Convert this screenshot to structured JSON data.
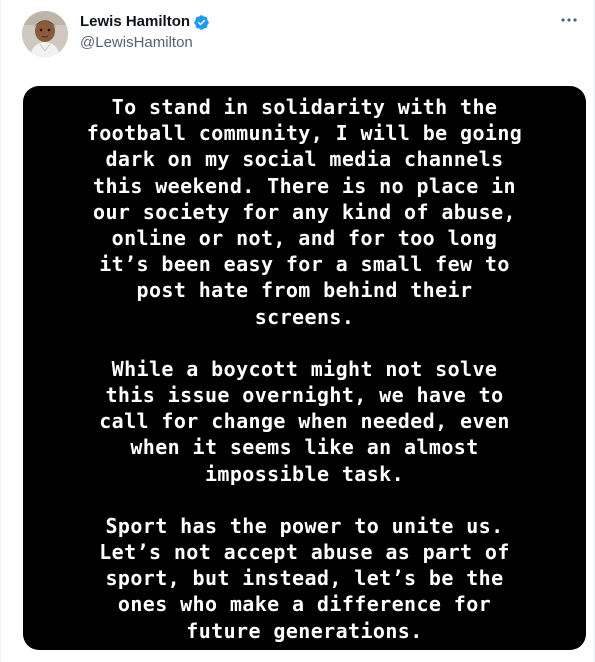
{
  "author": {
    "display_name": "Lewis Hamilton",
    "handle": "@LewisHamilton",
    "verified": true,
    "verified_color": "#1d9bf0",
    "avatar_icon": "avatar-photo"
  },
  "actions": {
    "more_icon": "more-horizontal-icon"
  },
  "media": {
    "background_color": "#000000",
    "text_color": "#ffffff",
    "paragraphs": [
      {
        "lines": [
          "To stand in solidarity with the",
          "football community, I will be going",
          "dark on my social media channels",
          "this weekend. There is no place in",
          "our society for any kind of abuse,",
          "online or not, and for too long",
          "it’s been easy for a small few to",
          "post hate from behind their",
          "screens."
        ]
      },
      {
        "lines": [
          "While a boycott might not solve",
          "this issue overnight, we have to",
          "call for change when needed, even",
          "when it seems like an almost",
          "impossible task."
        ]
      },
      {
        "lines": [
          "Sport has the power to unite us.",
          "Let’s not accept abuse as part of",
          "sport, but instead, let’s be the",
          "ones who make a difference for",
          "future generations."
        ]
      }
    ]
  }
}
